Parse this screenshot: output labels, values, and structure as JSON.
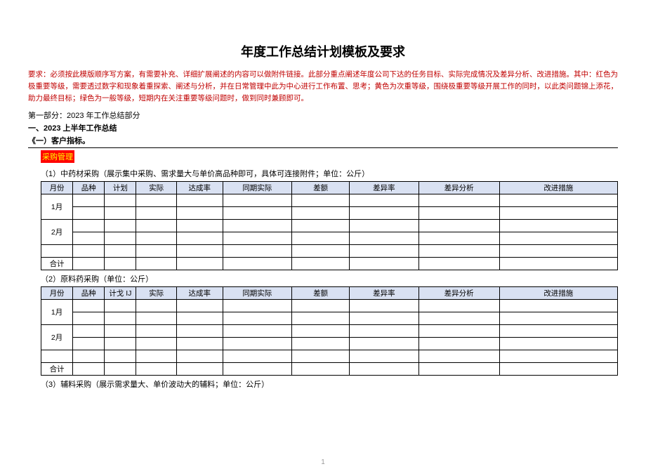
{
  "title": "年度工作总结计划模板及要求",
  "requirement": "要求：必须按此模版顺序写方案，有需要补充、详细扩展阐述的内容可以做附件链接。此部分重点阐述年度公司下达的任务目标、实际完成情况及差异分析、改进措施。其中：红色为极重要等级，需要透过数字和现象着重探索、阐述与分析，并在日常管理中此为中心进行工作布置、思考；黄色为次重等级，围绕极重要等级开展工作的同时，以此类问题锦上添花，助力最终目标；绿色为一般等级，短期内在关注重要等级问题时，做到同时兼顾即可。",
  "part1": "第一部分：2023 年工作总结部分",
  "section1": "一、2023 上半年工作总结",
  "kpi_heading": "《一）客户指标。",
  "highlight": "采购管理",
  "table1_title": "（1）中药材采购（展示集中采购、需求量大与单价高品种即可，具体可连接附件；单位：公斤）",
  "table2_title": "（2）原料药采购（单位：公斤）",
  "table3_title": "（3）辅料采购（展示需求量大、单价波动大的辅料；单位：公斤）",
  "headers": {
    "month": "月份",
    "pin": "品种",
    "plan": "计划",
    "plan2": "计戈 IJ",
    "actual": "实际",
    "rate": "达成率",
    "same": "同期实际",
    "diff": "差额",
    "diffrate": "差异率",
    "analysis": "差异分析",
    "action": "改进措施"
  },
  "rows": {
    "m1": "1月",
    "m2": "2月",
    "total": "合计"
  },
  "pagenum": "1"
}
